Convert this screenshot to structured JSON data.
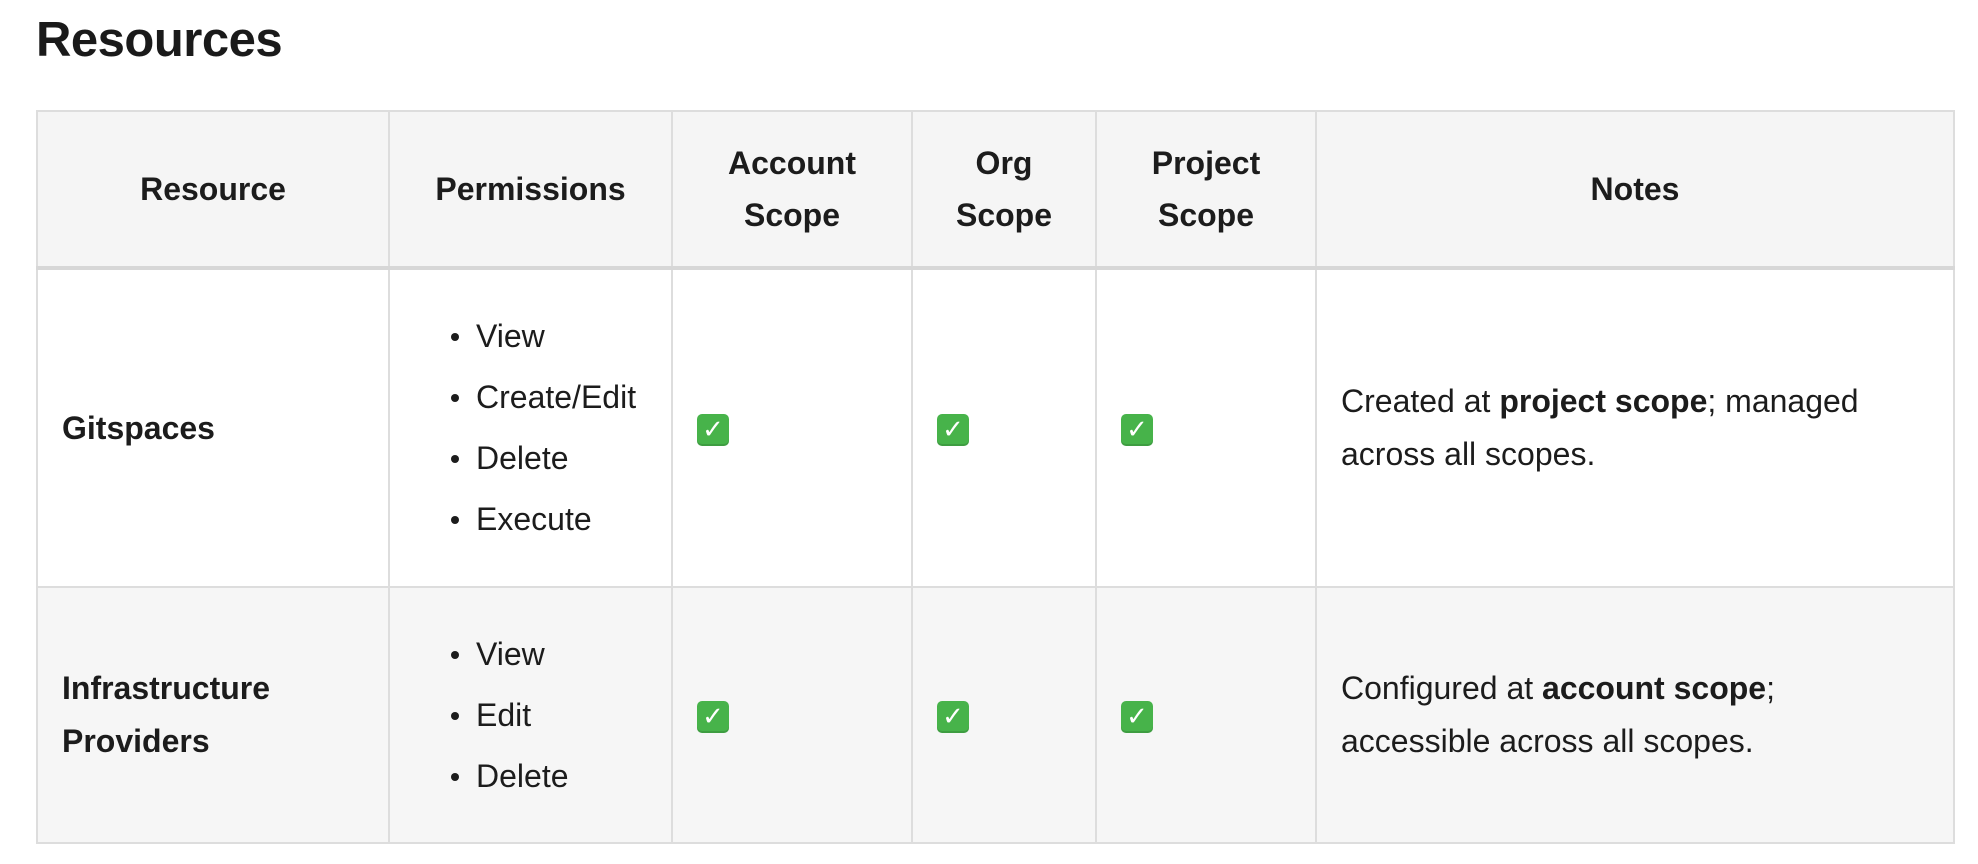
{
  "heading": "Resources",
  "columns": [
    "Resource",
    "Permissions",
    "Account Scope",
    "Org Scope",
    "Project Scope",
    "Notes"
  ],
  "check_symbol": "✓",
  "check_color": "#47b34a",
  "rows": [
    {
      "resource": "Gitspaces",
      "permissions": [
        "View",
        "Create/Edit",
        "Delete",
        "Execute"
      ],
      "account_scope": true,
      "org_scope": true,
      "project_scope": true,
      "notes": {
        "before": "Created at ",
        "bold": "project scope",
        "after": "; managed across all scopes."
      }
    },
    {
      "resource": "Infrastructure Providers",
      "permissions": [
        "View",
        "Edit",
        "Delete"
      ],
      "account_scope": true,
      "org_scope": true,
      "project_scope": true,
      "notes": {
        "before": "Configured at ",
        "bold": "account scope",
        "after": "; accessible across all scopes."
      }
    }
  ]
}
